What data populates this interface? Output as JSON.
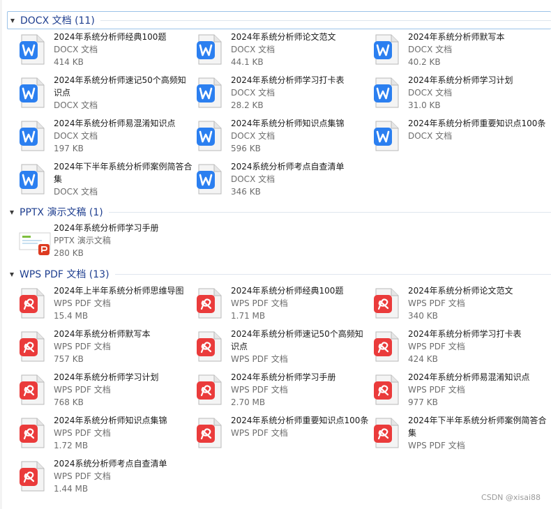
{
  "colors": {
    "header_text": "#1e3e8f",
    "docx_blue": "#2b7ff0",
    "pdf_red": "#ea3b3b",
    "pptx_orange": "#dd3b21"
  },
  "groups": [
    {
      "title": "DOCX 文档 (11)",
      "icon": "word-doc-icon",
      "items": [
        {
          "name": "2024年系统分析师经典100题",
          "type": "DOCX 文档",
          "size": "414 KB"
        },
        {
          "name": "2024年系统分析师论文范文",
          "type": "DOCX 文档",
          "size": "44.1 KB"
        },
        {
          "name": "2024年系统分析师默写本",
          "type": "DOCX 文档",
          "size": "40.2 KB"
        },
        {
          "name": "2024年系统分析师速记50个高频知识点",
          "type": "DOCX 文档",
          "size": ""
        },
        {
          "name": "2024年系统分析师学习打卡表",
          "type": "DOCX 文档",
          "size": "28.2 KB"
        },
        {
          "name": "2024年系统分析师学习计划",
          "type": "DOCX 文档",
          "size": "31.0 KB"
        },
        {
          "name": "2024年系统分析师易混淆知识点",
          "type": "DOCX 文档",
          "size": "197 KB"
        },
        {
          "name": "2024年系统分析师知识点集锦",
          "type": "DOCX 文档",
          "size": "596 KB"
        },
        {
          "name": "2024年系统分析师重要知识点100条",
          "type": "DOCX 文档",
          "size": ""
        },
        {
          "name": "2024年下半年系统分析师案例简答合集",
          "type": "DOCX 文档",
          "size": ""
        },
        {
          "name": "2024系统分析师考点自查清单",
          "type": "DOCX 文档",
          "size": "346 KB"
        }
      ]
    },
    {
      "title": "PPTX 演示文稿 (1)",
      "icon": "powerpoint-doc-icon",
      "items": [
        {
          "name": "2024年系统分析师学习手册",
          "type": "PPTX 演示文稿",
          "size": "280 KB"
        }
      ]
    },
    {
      "title": "WPS PDF 文档 (13)",
      "icon": "wps-pdf-icon",
      "items": [
        {
          "name": "2024年上半年系统分析师思维导图",
          "type": "WPS PDF 文档",
          "size": "15.4 MB"
        },
        {
          "name": "2024年系统分析师经典100题",
          "type": "WPS PDF 文档",
          "size": "1.71 MB"
        },
        {
          "name": "2024年系统分析师论文范文",
          "type": "WPS PDF 文档",
          "size": "340 KB"
        },
        {
          "name": "2024年系统分析师默写本",
          "type": "WPS PDF 文档",
          "size": "757 KB"
        },
        {
          "name": "2024年系统分析师速记50个高频知识点",
          "type": "WPS PDF 文档",
          "size": ""
        },
        {
          "name": "2024年系统分析师学习打卡表",
          "type": "WPS PDF 文档",
          "size": "424 KB"
        },
        {
          "name": "2024年系统分析师学习计划",
          "type": "WPS PDF 文档",
          "size": "768 KB"
        },
        {
          "name": "2024年系统分析师学习手册",
          "type": "WPS PDF 文档",
          "size": "2.70 MB"
        },
        {
          "name": "2024年系统分析师易混淆知识点",
          "type": "WPS PDF 文档",
          "size": "977 KB"
        },
        {
          "name": "2024年系统分析师知识点集锦",
          "type": "WPS PDF 文档",
          "size": "1.72 MB"
        },
        {
          "name": "2024年系统分析师重要知识点100条",
          "type": "WPS PDF 文档",
          "size": ""
        },
        {
          "name": "2024年下半年系统分析师案例简答合集",
          "type": "WPS PDF 文档",
          "size": ""
        },
        {
          "name": "2024系统分析师考点自查清单",
          "type": "WPS PDF 文档",
          "size": "1.44 MB"
        }
      ]
    }
  ],
  "watermark": "CSDN @xisai88"
}
